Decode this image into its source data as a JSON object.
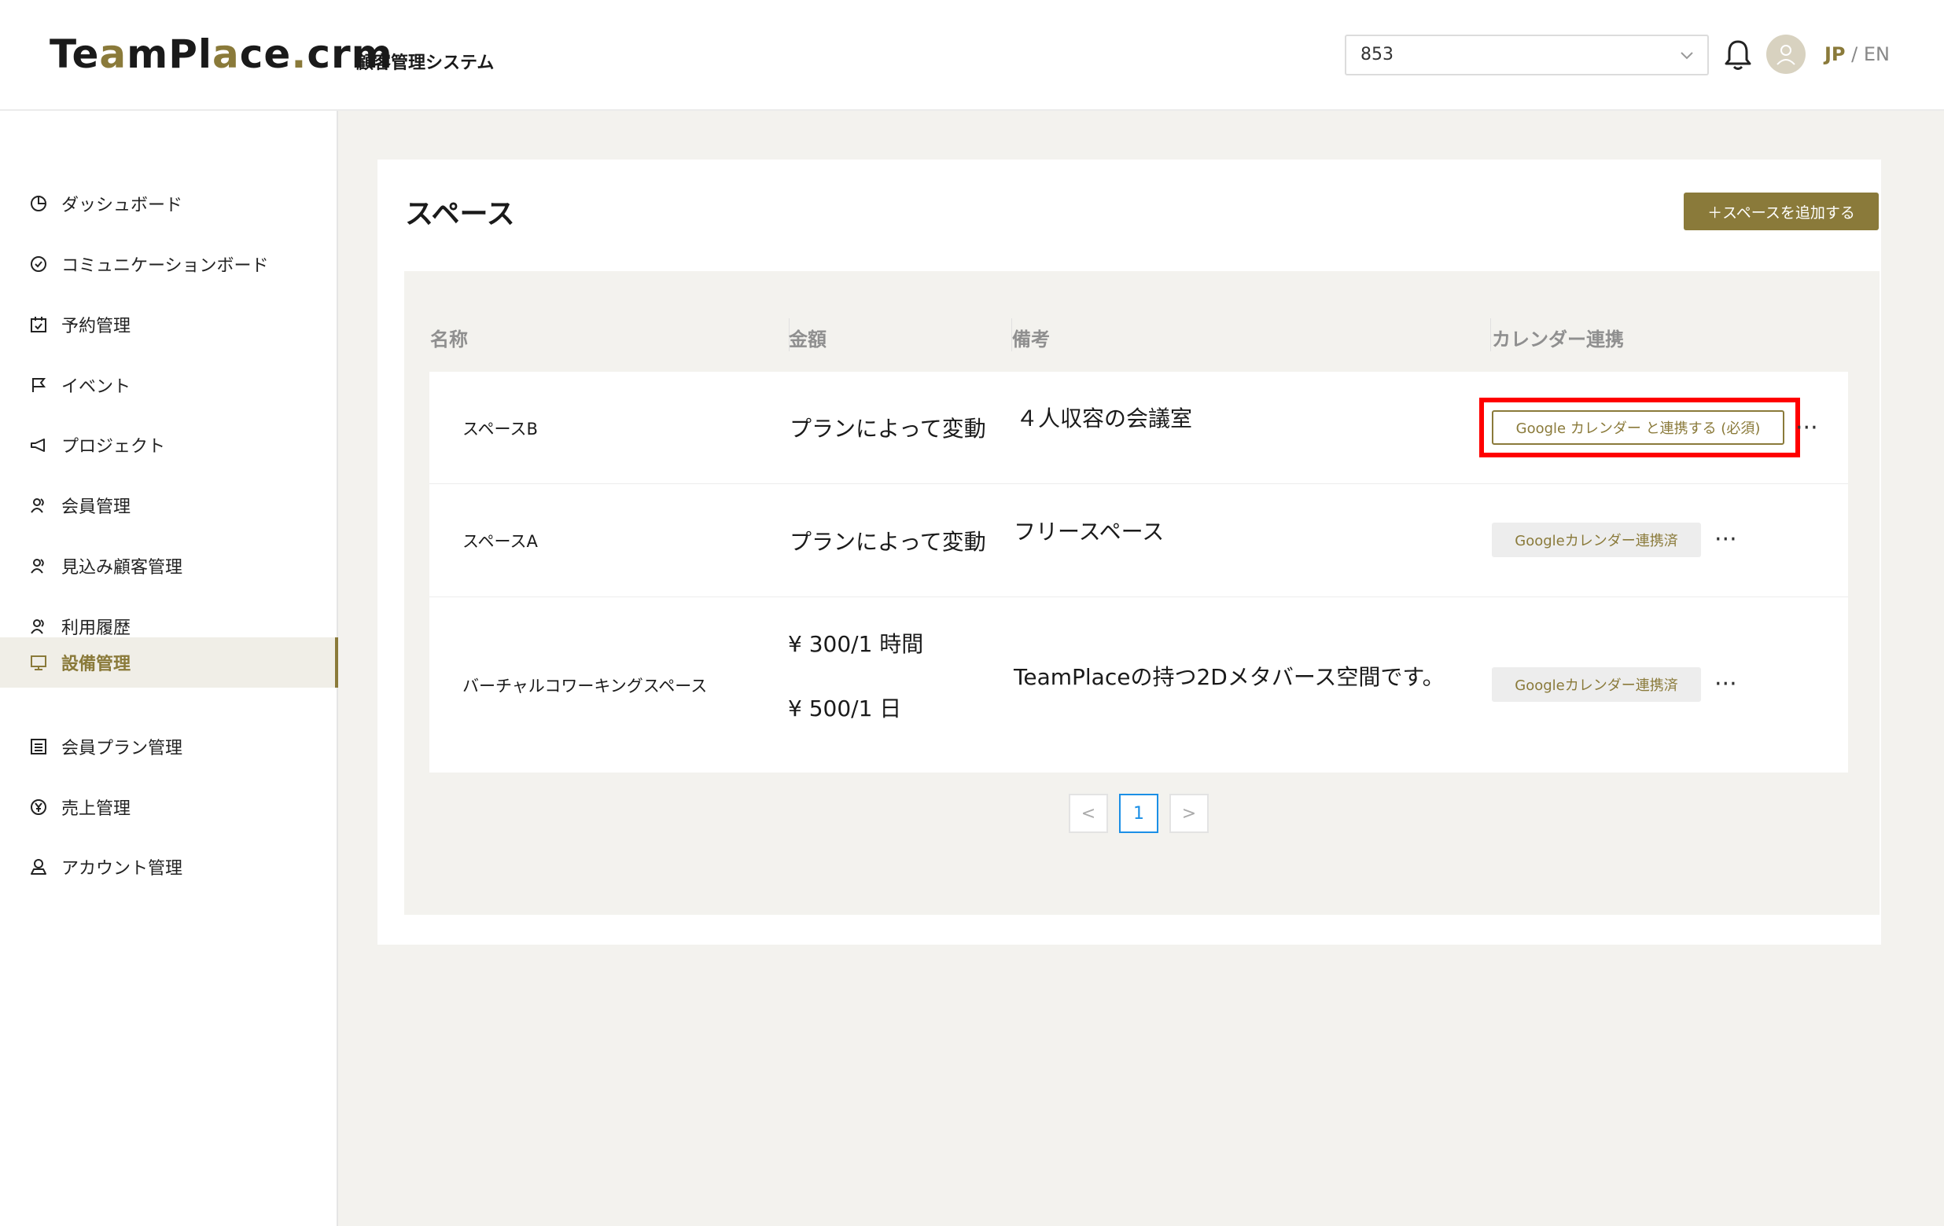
{
  "header": {
    "logo_part1": "Te",
    "logo_accent1": "a",
    "logo_part2": "mPl",
    "logo_accent2": "a",
    "logo_part3": "ce",
    "logo_dot": ".",
    "logo_part4": "crm",
    "subtitle": "顧客管理システム",
    "org_select_value": "853",
    "lang_active": "JP",
    "lang_sep": " / ",
    "lang_other": "EN"
  },
  "sidebar": {
    "items": [
      {
        "label": "ダッシュボード",
        "icon": "pie-chart-icon"
      },
      {
        "label": "コミュニケーションボード",
        "icon": "check-circle-icon"
      },
      {
        "label": "予約管理",
        "icon": "calendar-check-icon"
      },
      {
        "label": "イベント",
        "icon": "flag-icon"
      },
      {
        "label": "プロジェクト",
        "icon": "megaphone-icon"
      },
      {
        "label": "会員管理",
        "icon": "users-icon"
      },
      {
        "label": "見込み顧客管理",
        "icon": "users-icon"
      },
      {
        "label": "利用履歴",
        "icon": "users-icon"
      },
      {
        "label": "設備管理",
        "icon": "monitor-icon"
      },
      {
        "label": "会員プラン管理",
        "icon": "list-icon"
      },
      {
        "label": "売上管理",
        "icon": "yen-circle-icon"
      },
      {
        "label": "アカウント管理",
        "icon": "account-icon"
      }
    ],
    "active_index": 8,
    "accent_color": "#8a7a3a"
  },
  "main": {
    "title": "スペース",
    "add_button": "＋スペースを追加する",
    "columns": [
      "名称",
      "金額",
      "備考",
      "カレンダー連携"
    ],
    "rows": [
      {
        "name": "スペースB",
        "price": "プランによって変動",
        "remark": "４人収容の会議室",
        "calendar_button": "Google カレンダー と連携する (必須)"
      },
      {
        "name": "スペースA",
        "price": "プランによって変動",
        "remark": "フリースペース",
        "calendar_button": "Googleカレンダー連携済"
      },
      {
        "name": "バーチャルコワーキングスペース",
        "price_line1": "¥ 300/1 時間",
        "price_line2": "¥ 500/1 日",
        "remark": "TeamPlaceの持つ2Dメタバース空間です。",
        "calendar_button": "Googleカレンダー連携済"
      }
    ],
    "row_menu": "···",
    "pagination": {
      "prev": "<",
      "current": "1",
      "next": ">"
    }
  }
}
